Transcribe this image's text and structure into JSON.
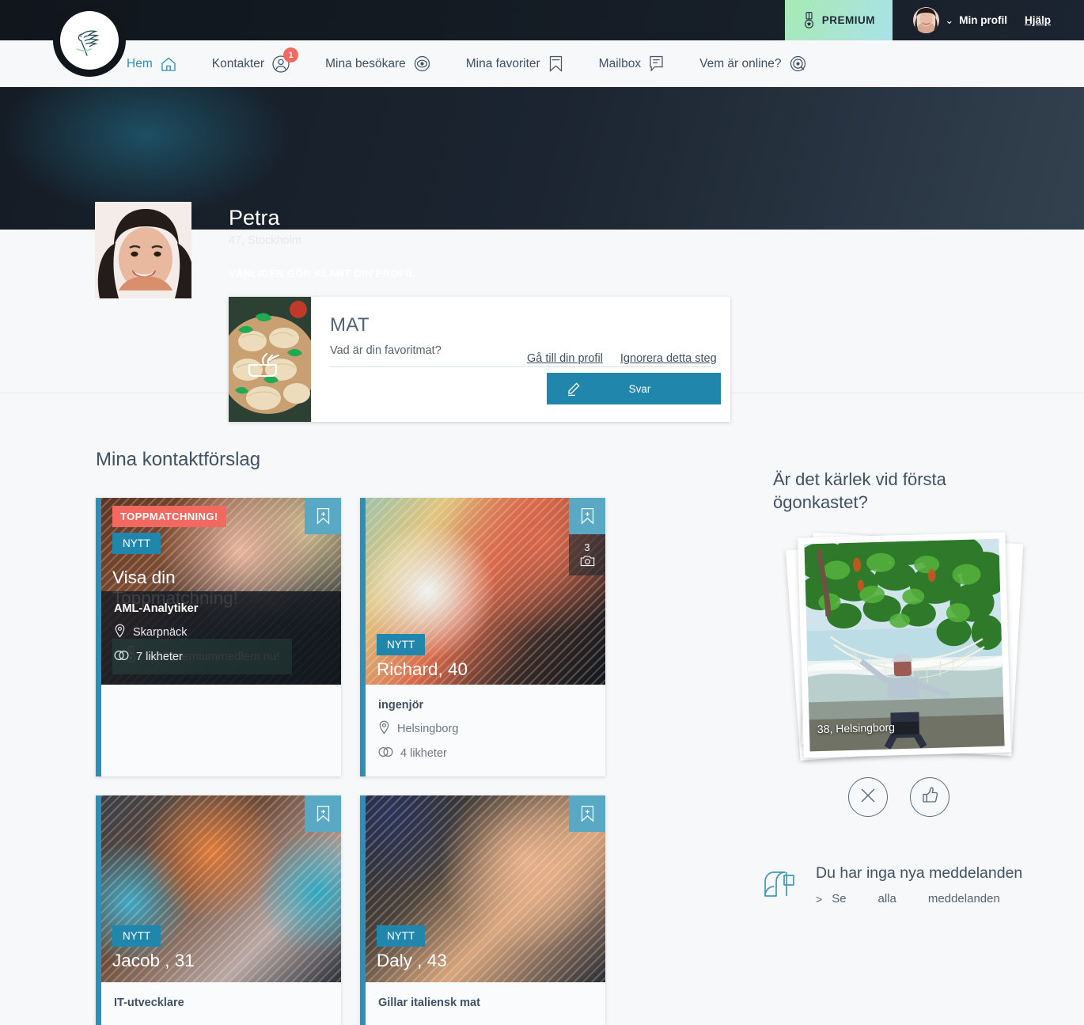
{
  "brand": {
    "logo_icon": "dove-olive-branch-logo",
    "accent": "#2a8fba",
    "danger": "#f4695f",
    "premium_green": "#71ce9d"
  },
  "topbar": {
    "premium": {
      "label": "PREMIUM",
      "icon": "medal-icon"
    },
    "profile": {
      "label": "Min profil",
      "chevron": "chevron-down-icon",
      "avatar_icon": "user-avatar"
    },
    "help": {
      "label": "Hjälp"
    }
  },
  "nav": {
    "items": [
      {
        "label": "Hem",
        "icon": "home-icon",
        "active": true,
        "badge": null
      },
      {
        "label": "Kontakter",
        "icon": "user-circle-icon",
        "active": false,
        "badge": "1"
      },
      {
        "label": "Mina besökare",
        "icon": "eye-icon",
        "active": false,
        "badge": null
      },
      {
        "label": "Mina favoriter",
        "icon": "bookmark-icon",
        "active": false,
        "badge": null
      },
      {
        "label": "Mailbox",
        "icon": "speech-bubble-icon",
        "active": false,
        "badge": null
      },
      {
        "label": "Vem är online?",
        "icon": "target-circle-icon",
        "active": false,
        "badge": null
      }
    ]
  },
  "hero": {
    "name": "Petra",
    "subtitle": "47, Stockholm",
    "cta_text": "VÄNLIGEN GÖR KLART DIN PROFIL",
    "question_card": {
      "title": "MAT",
      "question": "Vad är din favoritmat?",
      "image_icon": "pasta-bowl-photo",
      "button": {
        "label": "Svar",
        "icon": "pencil-icon"
      }
    },
    "links": [
      {
        "label": "Gå till din profil"
      },
      {
        "label": "Ignorera detta steg"
      }
    ]
  },
  "main": {
    "section_title": "Mina kontaktförslag",
    "cards": [
      {
        "top_tag": "TOPPMATCHNING!",
        "new_tag": "NYTT",
        "title": "Visa din Toppmatchning!",
        "premium_cta": "> Bli premiummedlem nu!",
        "premium_cta_icon": "medal-icon",
        "job": "AML-Analytiker",
        "location": "Skarpnäck",
        "similarities": "7 likheter",
        "bookmark_icon": "bookmark-plus-icon",
        "photo_count": null
      },
      {
        "top_tag": null,
        "new_tag": "NYTT",
        "title": "Richard, 40",
        "premium_cta": null,
        "job": "ingenjör",
        "location": "Helsingborg",
        "similarities": "4 likheter",
        "bookmark_icon": "bookmark-plus-icon",
        "photo_count": "3",
        "photo_count_icon": "camera-icon"
      },
      {
        "top_tag": null,
        "new_tag": "NYTT",
        "title": "Jacob , 31",
        "premium_cta": null,
        "job": "IT-utvecklare",
        "location": "",
        "similarities": "",
        "bookmark_icon": "bookmark-plus-icon",
        "photo_count": null
      },
      {
        "top_tag": null,
        "new_tag": "NYTT",
        "title": "Daly , 43",
        "premium_cta": null,
        "job": "Gillar italiensk mat",
        "location": "",
        "similarities": "",
        "bookmark_icon": "bookmark-plus-icon",
        "photo_count": null
      }
    ]
  },
  "rail": {
    "title": "Är det kärlek vid första ögonkastet?",
    "photo_caption": "38, Helsingborg",
    "photo_icon": "hammock-beach-photo",
    "vote": {
      "reject_icon": "x-icon",
      "like_icon": "thumbs-up-icon"
    },
    "mailbox": {
      "icon": "mailbox-icon",
      "empty_text": "Du har inga nya meddelanden",
      "link_chevron": ">",
      "link_part1": "Se",
      "link_part2": "alla",
      "link_part3": "meddelanden"
    }
  }
}
